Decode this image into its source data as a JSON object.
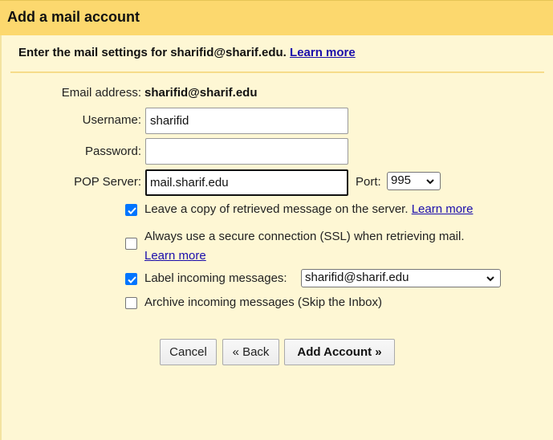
{
  "dialog": {
    "title": "Add a mail account",
    "subtitle_prefix": "Enter the mail settings for sharifid@sharif.edu.",
    "subtitle_link": "Learn more"
  },
  "form": {
    "email_label": "Email address:",
    "email_value": "sharifid@sharif.edu",
    "username_label": "Username:",
    "username_value": "sharifid",
    "password_label": "Password:",
    "password_value": "",
    "pop_label": "POP Server:",
    "pop_value": "mail.sharif.edu",
    "port_label": "Port:",
    "port_value": "995"
  },
  "options": {
    "leave_copy": {
      "label": "Leave a copy of retrieved message on the server.",
      "link": "Learn more",
      "checked": true
    },
    "ssl": {
      "label": "Always use a secure connection (SSL) when retrieving mail.",
      "link": "Learn more",
      "checked": false
    },
    "label_incoming": {
      "label": "Label incoming messages:",
      "select_value": "sharifid@sharif.edu",
      "checked": true
    },
    "archive": {
      "label": "Archive incoming messages (Skip the Inbox)",
      "checked": false
    }
  },
  "buttons": {
    "cancel": "Cancel",
    "back": "« Back",
    "add": "Add Account »"
  },
  "colors": {
    "titlebar": "#fcd86e",
    "background": "#fef7d4",
    "link": "#1a0dab",
    "checkbox": "#0075ff"
  },
  "icons": {
    "checkmark": "checkmark-icon",
    "dropdown": "chevron-down-icon"
  }
}
